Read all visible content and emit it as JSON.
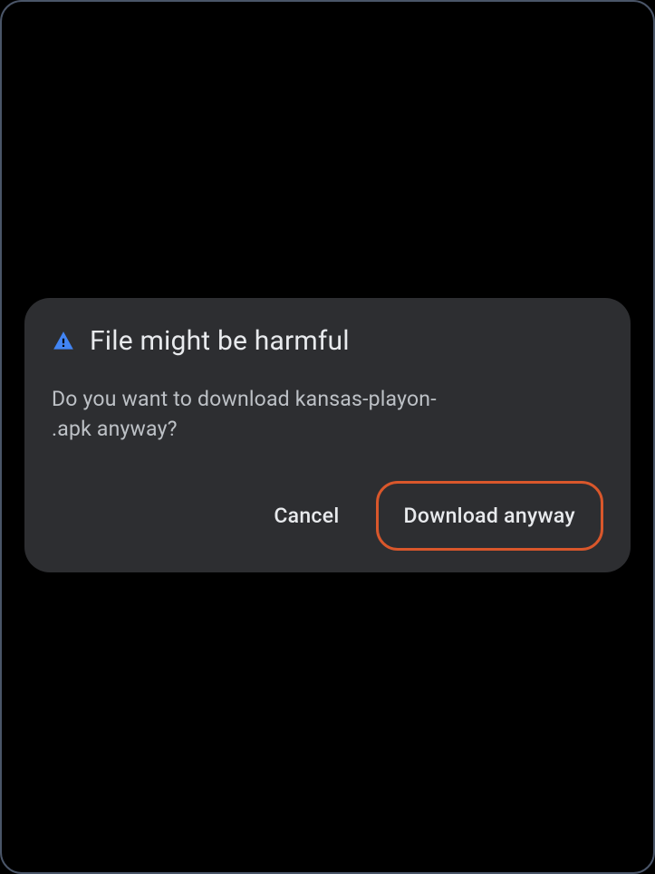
{
  "dialog": {
    "title": "File might be harmful",
    "message_prefix": "Do you want to download kansas-playon-",
    "message_suffix": ".apk anyway?",
    "cancel_label": "Cancel",
    "download_label": "Download anyway"
  },
  "colors": {
    "warning_icon": "#4285f4",
    "highlight_border": "#d9572b"
  }
}
